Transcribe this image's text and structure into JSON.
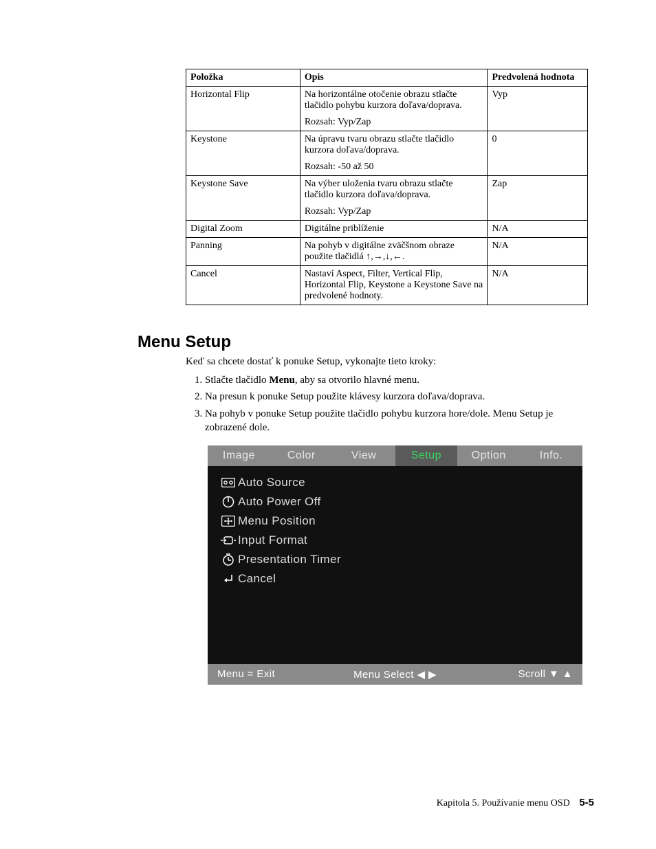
{
  "table": {
    "headers": {
      "polozka": "Položka",
      "opis": "Opis",
      "pred": "Predvolená hodnota"
    },
    "rows": [
      {
        "polozka": "Horizontal Flip",
        "opis_main": "Na horizontálne otočenie obrazu stlačte tlačidlo pohybu kurzora doľava/doprava.",
        "opis_range": "Rozsah: Vyp/Zap",
        "pred": "Vyp"
      },
      {
        "polozka": "Keystone",
        "opis_main": "Na úpravu tvaru obrazu stlačte tlačidlo kurzora doľava/doprava.",
        "opis_range": "Rozsah: -50 až 50",
        "pred": "0"
      },
      {
        "polozka": "Keystone Save",
        "opis_main": "Na výber uloženia tvaru obrazu stlačte tlačidlo kurzora doľava/doprava.",
        "opis_range": "Rozsah: Vyp/Zap",
        "pred": "Zap"
      },
      {
        "polozka": "Digital Zoom",
        "opis_main": "Digitálne priblíženie",
        "opis_range": "",
        "pred": "N/A"
      },
      {
        "polozka": "Panning",
        "opis_main": "Na pohyb v digitálne zväčšnom obraze použite tlačidlá ↑,→,↓,←.",
        "opis_range": "",
        "pred": "N/A"
      },
      {
        "polozka": "Cancel",
        "opis_main": "Nastaví Aspect, Filter, Vertical Flip, Horizontal Flip, Keystone a Keystone Save na predvolené hodnoty.",
        "opis_range": "",
        "pred": "N/A"
      }
    ]
  },
  "section": {
    "title": "Menu Setup",
    "intro": "Keď sa chcete dostať k ponuke Setup, vykonajte tieto kroky:",
    "steps": {
      "s1_prefix": "Stlačte tlačidlo ",
      "s1_bold": "Menu",
      "s1_suffix": ", aby sa otvorilo hlavné menu.",
      "s2": "Na presun k ponuke Setup použite klávesy kurzora doľava/doprava.",
      "s3": "Na pohyb v ponuke Setup použite tlačidlo pohybu kurzora hore/dole. Menu Setup je zobrazené dole."
    }
  },
  "osd": {
    "tabs": [
      {
        "label": "Image",
        "active": false
      },
      {
        "label": "Color",
        "active": false
      },
      {
        "label": "View",
        "active": false
      },
      {
        "label": "Setup",
        "active": true
      },
      {
        "label": "Option",
        "active": false
      },
      {
        "label": "Info.",
        "active": false
      }
    ],
    "items": [
      {
        "icon": "auto-source-icon",
        "label": "Auto Source"
      },
      {
        "icon": "power-icon",
        "label": "Auto Power Off"
      },
      {
        "icon": "menu-position-icon",
        "label": "Menu Position"
      },
      {
        "icon": "input-format-icon",
        "label": "Input Format"
      },
      {
        "icon": "presentation-timer-icon",
        "label": "Presentation Timer"
      },
      {
        "icon": "return-icon",
        "label": "Cancel"
      }
    ],
    "foot": {
      "left": "Menu = Exit",
      "center": "Menu Select ◀ ▶",
      "right": "Scroll ▼ ▲"
    }
  },
  "footer": {
    "chapter": "Kapitola 5. Používanie menu OSD",
    "page": "5-5"
  }
}
